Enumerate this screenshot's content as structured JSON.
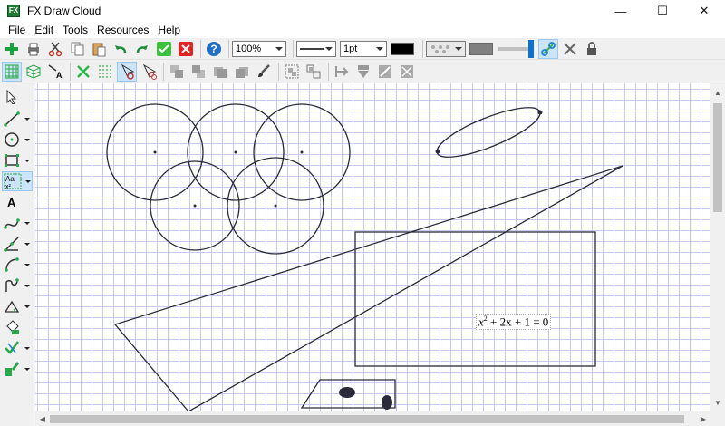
{
  "window": {
    "title": "FX Draw Cloud",
    "app_icon_text": "FX",
    "min_symbol": "—",
    "max_symbol": "☐",
    "close_symbol": "✕"
  },
  "menu": [
    "File",
    "Edit",
    "Tools",
    "Resources",
    "Help"
  ],
  "toolbar": {
    "zoom": "100%",
    "line_thickness": "1pt",
    "line_color": "#000000"
  },
  "canvas": {
    "equation": {
      "pre": "x",
      "exp": "2",
      "post": " + 2x + 1  =  0"
    }
  },
  "colors": {
    "grid": "#c9c9f0",
    "shape_stroke": "#2a2a3a",
    "active_tool": "#cce4f7"
  },
  "icons": {
    "toolbar1": [
      "add-icon",
      "print-icon",
      "cut-icon",
      "copy-icon",
      "paste-icon",
      "undo-icon",
      "redo-icon",
      "ok-icon",
      "cancel-icon",
      "help-icon"
    ],
    "toolbar1_right": [
      "fill-pattern-icon",
      "fill-color-icon",
      "transparency-slider",
      "link-icon",
      "unlink-icon",
      "lock-icon"
    ],
    "toolbar2": [
      "grid-icon",
      "3d-grid-icon",
      "text-snap-icon",
      "cross-icon",
      "dot-grid-icon",
      "pointer-snap-icon",
      "pointer-link-icon",
      "move-back-icon",
      "move-front-icon",
      "layer-icon",
      "layer-icon",
      "brush-icon",
      "group-icon",
      "ungroup-icon",
      "align-icon",
      "arrow-down-icon",
      "flip-icon",
      "rotate-icon"
    ],
    "left": [
      "select-tool",
      "line-tool",
      "circle-tool",
      "rectangle-tool",
      "text-box-tool",
      "text-tool",
      "curve-tool",
      "angle-tool",
      "arc-tool",
      "function-tool",
      "triangle-tool",
      "fill-tool",
      "check-tool",
      "graph-tool"
    ]
  }
}
